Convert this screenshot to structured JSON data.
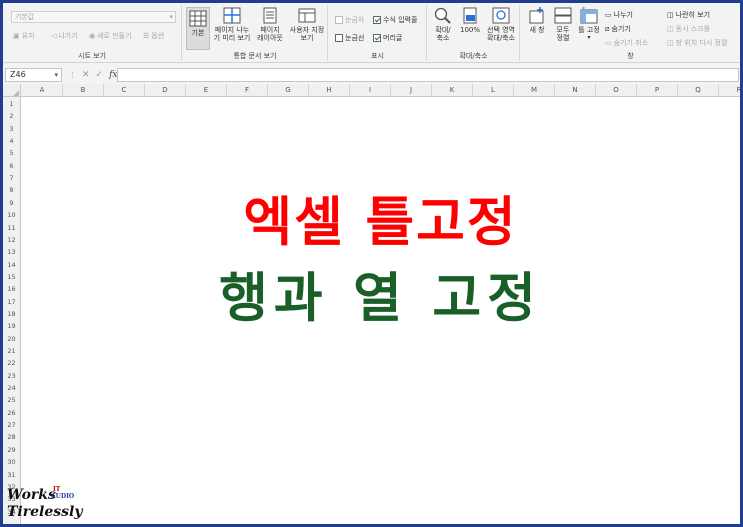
{
  "ribbon": {
    "sheet_view": {
      "dropdown_value": "기본값",
      "keep": "유지",
      "exit": "나가기",
      "new": "새로 만들기",
      "options": "옵션",
      "label": "시트 보기"
    },
    "workbook_views": {
      "normal": "기본",
      "page_break_1": "페이지 나누",
      "page_break_2": "기 미리 보기",
      "page_layout_1": "페이지",
      "page_layout_2": "레이아웃",
      "custom_1": "사용자 지정",
      "custom_2": "보기",
      "label": "통합 문서 보기"
    },
    "show": {
      "ruler": "눈금자",
      "formula_bar": "수식 입력줄",
      "gridlines": "눈금선",
      "headings": "머리글",
      "label": "표시"
    },
    "zoom": {
      "zoom_1": "확대/",
      "zoom_2": "축소",
      "hundred": "100%",
      "selection_1": "선택 영역",
      "selection_2": "확대/축소",
      "label": "확대/축소"
    },
    "window": {
      "new_window": "새 창",
      "arrange_1": "모두",
      "arrange_2": "정렬",
      "freeze": "틀 고정",
      "split": "나누기",
      "hide": "숨기기",
      "unhide": "숨기기 취소",
      "side_by_side": "나란히 보기",
      "sync_scroll": "동시 스크롤",
      "reset_pos": "창 위치 다시 정렬",
      "label": "창"
    }
  },
  "formula_bar": {
    "name_box": "Z46",
    "fx": "fx",
    "formula": ""
  },
  "columns": [
    "A",
    "B",
    "C",
    "D",
    "E",
    "F",
    "G",
    "H",
    "I",
    "J",
    "K",
    "L",
    "M",
    "N",
    "O",
    "P",
    "Q",
    "R"
  ],
  "rows": [
    "1",
    "2",
    "3",
    "4",
    "5",
    "6",
    "7",
    "8",
    "9",
    "10",
    "11",
    "12",
    "13",
    "14",
    "15",
    "16",
    "17",
    "18",
    "19",
    "20",
    "21",
    "22",
    "23",
    "24",
    "25",
    "26",
    "27",
    "28",
    "29",
    "30",
    "31",
    "32",
    "33",
    "34"
  ],
  "content": {
    "title_line1": "엑셀 틀고정",
    "title_line2": "행과 열 고정",
    "title1_color": "#ff0000",
    "title2_color": "#1a5e28"
  },
  "logo": {
    "works": "Works",
    "it": "IT",
    "audio": "AUDIO",
    "tirelessly": "Tirelessly"
  }
}
